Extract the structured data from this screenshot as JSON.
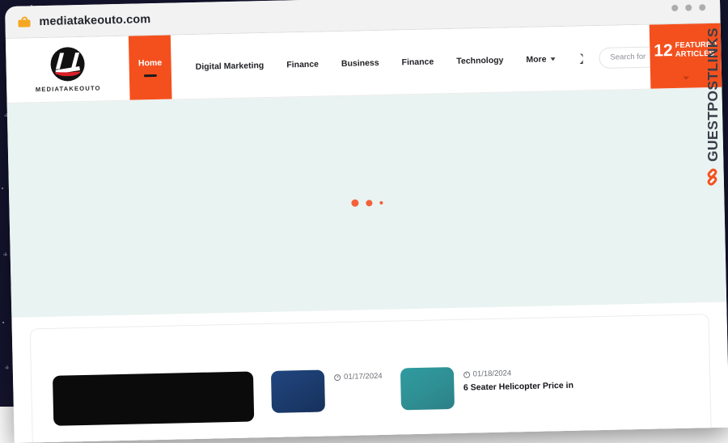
{
  "backdrop": {
    "color": "#14142e"
  },
  "browser": {
    "url": "mediatakeouto.com",
    "lock_icon": "lock-icon",
    "window_dots": [
      "dot",
      "dot",
      "dot"
    ]
  },
  "site": {
    "logo": {
      "icon": "mediatakeouto-logo-icon",
      "text": "MEDIATAKEOUTO"
    },
    "nav": {
      "home_label": "Home",
      "items": [
        {
          "label": "Digital Marketing"
        },
        {
          "label": "Finance"
        },
        {
          "label": "Business"
        },
        {
          "label": "Finance"
        },
        {
          "label": "Technology"
        }
      ],
      "more_label": "More",
      "dark_mode_icon": "moon-icon"
    },
    "search": {
      "placeholder": "Search for",
      "value": "",
      "icon": "search-icon"
    },
    "featured": {
      "count": "12",
      "line1": "FEATURED",
      "line2": "ARTICLES",
      "accent": "#f4501e"
    }
  },
  "body": {
    "state": "loading",
    "background": "#e9f3f1",
    "loader_dots": 3,
    "loader_color": "#f4603a"
  },
  "articles": [
    {
      "thumb": "wide-black-thumbnail",
      "date": "",
      "title": ""
    },
    {
      "thumb": "navy-thumbnail",
      "date": "01/17/2024",
      "title": "",
      "clock_icon": "clock-icon"
    },
    {
      "thumb": "teal-thumbnail",
      "date": "01/18/2024",
      "title": "6 Seater Helicopter Price in",
      "clock_icon": "clock-icon"
    }
  ],
  "brand_rail": {
    "text": "GUESTPOSTLINKS",
    "icon": "chain-link-icon",
    "accent": "#f4501e"
  }
}
